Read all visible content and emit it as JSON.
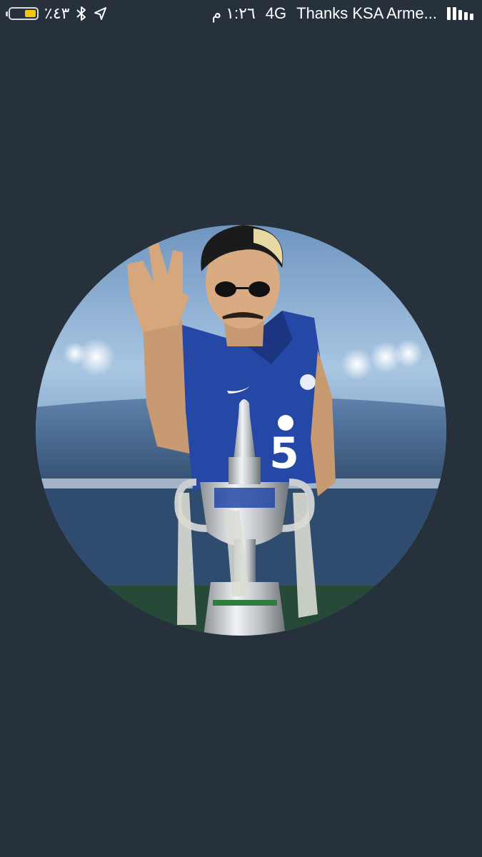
{
  "status_bar": {
    "battery_percent": "٪٤٣",
    "battery_level": 0.43,
    "time": "١:٢٦ م",
    "network": "4G",
    "carrier": "Thanks KSA Arme...",
    "signal_bars": 5,
    "icons": [
      "battery-icon",
      "bluetooth-icon",
      "location-arrow-icon",
      "signal-bars-icon"
    ]
  },
  "avatar": {
    "description_name": "profile-photo",
    "jersey_number": "5",
    "colors": {
      "background": "#27313c",
      "jersey": "#2547a6",
      "sky": "#9fc1e0",
      "stadium": "#5a7fa8",
      "trophy": "#c9ccd0",
      "accent_yellow": "#f4c70b"
    }
  }
}
